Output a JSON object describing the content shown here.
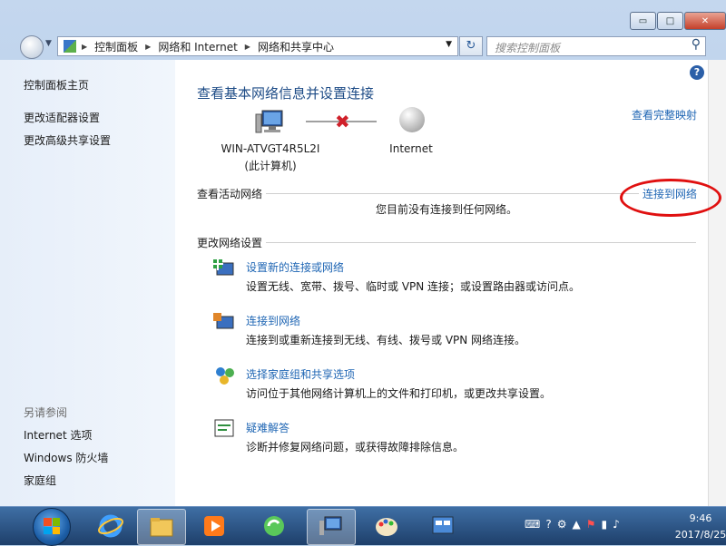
{
  "window": {
    "controls": {
      "minimize": "▭",
      "maximize": "□",
      "close": "✕"
    }
  },
  "navbar": {
    "breadcrumbs": [
      "控制面板",
      "网络和 Internet",
      "网络和共享中心"
    ],
    "search_placeholder": "搜索控制面板",
    "refresh_glyph": "↻",
    "search_glyph": "⚲"
  },
  "sidebar": {
    "items": [
      {
        "label": "控制面板主页"
      },
      {
        "label": "更改适配器设置"
      },
      {
        "label": "更改高级共享设置"
      }
    ],
    "see_also_title": "另请参阅",
    "see_also": [
      {
        "label": "Internet 选项"
      },
      {
        "label": "Windows 防火墙"
      },
      {
        "label": "家庭组"
      }
    ]
  },
  "main": {
    "help_glyph": "?",
    "title": "查看基本网络信息并设置连接",
    "full_map_link": "查看完整映射",
    "computer_name": "WIN-ATVGT4R5L2I",
    "computer_sub": "(此计算机)",
    "internet_label": "Internet",
    "active_networks_title": "查看活动网络",
    "connect_link": "连接到网络",
    "no_connection_text": "您目前没有连接到任何网络。",
    "change_settings_title": "更改网络设置",
    "tasks": [
      {
        "link": "设置新的连接或网络",
        "desc": "设置无线、宽带、拨号、临时或 VPN 连接；或设置路由器或访问点。"
      },
      {
        "link": "连接到网络",
        "desc": "连接到或重新连接到无线、有线、拨号或 VPN 网络连接。"
      },
      {
        "link": "选择家庭组和共享选项",
        "desc": "访问位于其他网络计算机上的文件和打印机，或更改共享设置。"
      },
      {
        "link": "疑难解答",
        "desc": "诊断并修复网络问题，或获得故障排除信息。"
      }
    ]
  },
  "taskbar": {
    "time": "9:46",
    "date": "2017/8/25"
  },
  "colors": {
    "link": "#1f66b4",
    "title": "#1d4b86",
    "highlight": "#e01010"
  }
}
